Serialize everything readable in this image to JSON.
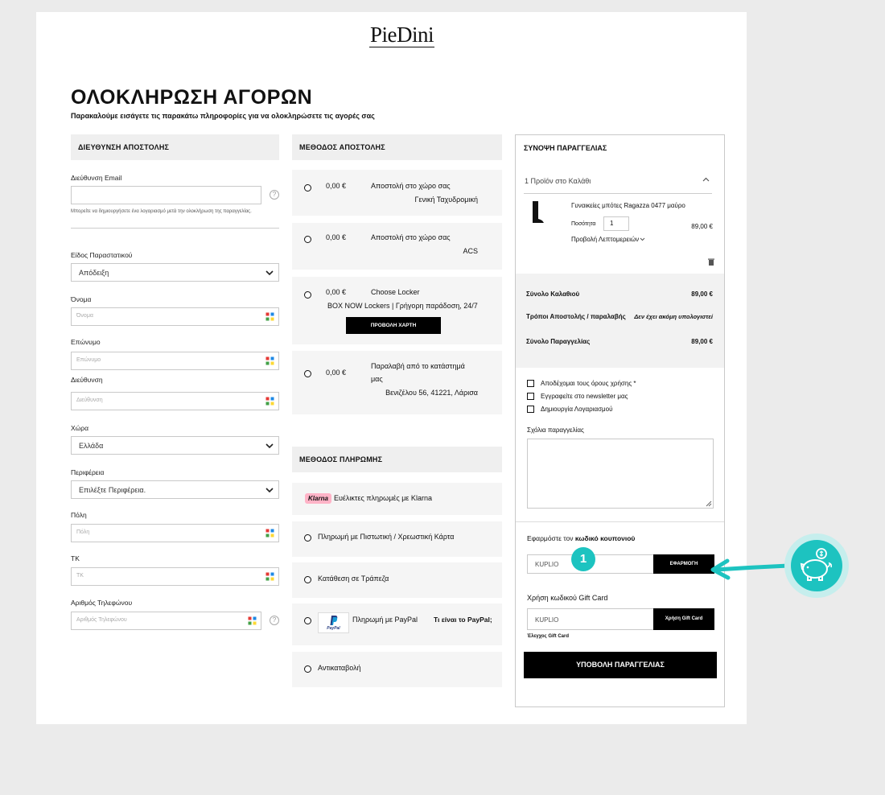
{
  "brand": {
    "logo_text": "PieDini"
  },
  "header": {
    "title": "ΟΛΟΚΛΗΡΩΣΗ ΑΓΟΡΩΝ",
    "subtitle": "Παρακαλούμε εισάγετε τις παρακάτω πληροφορίες για να ολοκληρώσετε τις αγορές σας"
  },
  "shipping_address": {
    "heading": "ΔΙΕΥΘΥΝΣΗ ΑΠΟΣΤΟΛΗΣ",
    "email_label": "Διεύθυνση Email",
    "email_value": "",
    "email_help": "?",
    "email_note": "Μπορείτε να δημιουργήσετε ένα λογαριασμό μετά την ολοκλήρωση της παραγγελίας.",
    "doc_type_label": "Είδος Παραστατικού",
    "doc_type_value": "Απόδειξη",
    "firstname_label": "Όνομα",
    "firstname_placeholder": "Όνομα",
    "lastname_label": "Επώνυμο",
    "lastname_placeholder": "Επώνυμο",
    "address_label": "Διεύθυνση",
    "address_placeholder": "Διεύθυνση",
    "country_label": "Χώρα",
    "country_value": "Ελλάδα",
    "region_label": "Περιφέρεια",
    "region_value": "Επιλέξτε Περιφέρεια.",
    "city_label": "Πόλη",
    "city_placeholder": "Πόλη",
    "zip_label": "ΤΚ",
    "zip_placeholder": "ΤΚ",
    "phone_label": "Αριθμός Τηλεφώνου",
    "phone_placeholder": "Αριθμός Τηλεφώνου",
    "phone_help": "?"
  },
  "shipping_method": {
    "heading": "ΜΕΘΟΔΟΣ ΑΠΟΣΤΟΛΗΣ",
    "options": [
      {
        "price": "0,00 €",
        "title": "Αποστολή στο χώρο σας",
        "carrier": "Γενική Ταχυδρομική"
      },
      {
        "price": "0,00 €",
        "title": "Αποστολή στο χώρο σας",
        "carrier": "ACS"
      },
      {
        "price": "0,00 €",
        "title": "Choose Locker",
        "carrier": "BOX NOW Lockers | Γρήγορη παράδοση, 24/7",
        "button": "ΠΡΟΒΟΛΗ ΧΑΡΤΗ"
      },
      {
        "price": "0,00 €",
        "title": "Παραλαβή από το κατάστημά",
        "title2": "μας",
        "carrier": "Βενιζέλου 56, 41221, Λάρισα"
      }
    ]
  },
  "payment_method": {
    "heading": "ΜΕΘΟΔΟΣ ΠΛΗΡΩΜΗΣ",
    "klarna_badge": "Klarna",
    "klarna_label": "Ευέλικτες πληρωμές με Klarna",
    "card_label": "Πληρωμή με Πιστωτική / Χρεωστική Κάρτα",
    "bank_label": "Κατάθεση σε Τράπεζα",
    "paypal_logo": "PayPal",
    "paypal_label": "Πληρωμή με PayPal",
    "paypal_link": "Τι είναι το PayPal;",
    "cod_label": "Αντικαταβολή"
  },
  "summary": {
    "heading": "ΣΥΝΟΨΗ ΠΑΡΑΓΓΕΛΙΑΣ",
    "cart_count": "1 Προϊόν στο Καλάθι",
    "product_name": "Γυναικείες μπότες Ragazza 0477 μαύρο",
    "qty_label": "Ποσότητα",
    "qty_value": "1",
    "product_price": "89,00 €",
    "details_link": "Προβολή Λεπτομερειών",
    "cart_total_label": "Σύνολο Καλαθιού",
    "cart_total_value": "89,00 €",
    "shipping_label": "Τρόποι Αποστολής / παραλαβής",
    "shipping_value": "Δεν έχει ακόμη υπολογιστεί",
    "order_total_label": "Σύνολο Παραγγελίας",
    "order_total_value": "89,00 €",
    "terms_label": "Αποδέχομαι τους όρους χρήσης *",
    "newsletter_label": "Εγγραφείτε στο newsletter μας",
    "account_label": "Δημιουργία Λογαριασμού",
    "comments_label": "Σχόλια παραγγελίας",
    "comments_value": "",
    "coupon_heading_prefix": "Εφαρμόστε τον",
    "coupon_heading_bold": "κωδικό κουπονιού",
    "coupon_value": "KUPLIO",
    "coupon_button": "ΕΦΑΡΜΟΓΗ",
    "giftcard_heading": "Χρήση κωδικού Gift Card",
    "giftcard_value": "KUPLIO",
    "giftcard_button": "Χρήση Gift Card",
    "giftcard_check": "Έλεγχος Gift Card",
    "submit_button": "ΥΠΟΒΟΛΗ ΠΑΡΑΓΓΕΛΙΑΣ"
  },
  "annotation": {
    "step_number": "1",
    "accent_color": "#1dc3c0"
  }
}
